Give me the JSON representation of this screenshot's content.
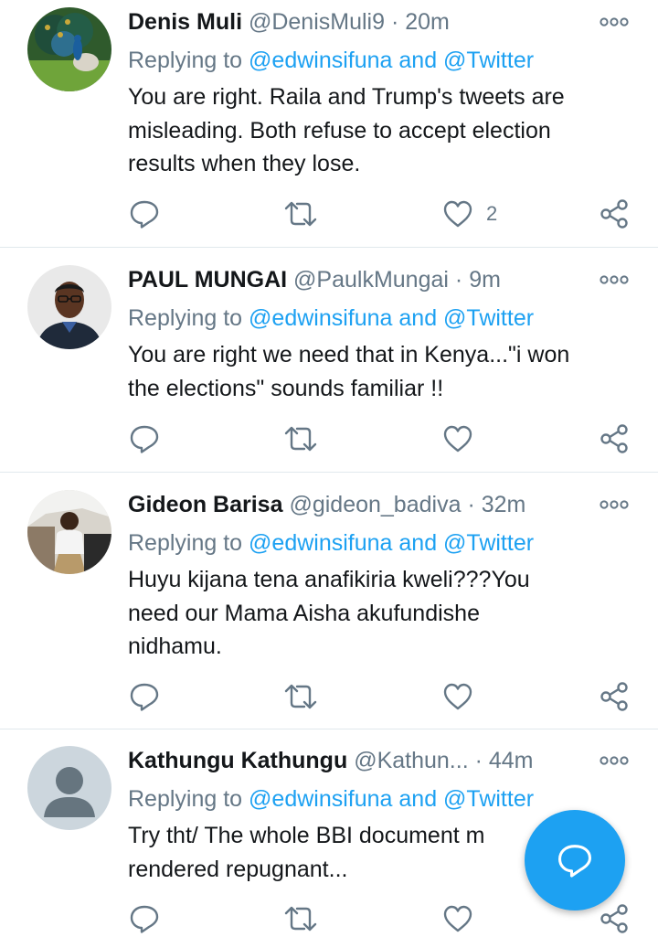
{
  "tweets": [
    {
      "name": "Denis Muli",
      "handle": "@DenisMuli9",
      "dot": "·",
      "time": "20m",
      "reply_prefix": "Replying to",
      "reply_to": "@edwinsifuna and @Twitter",
      "lines": [
        "You are right. Raila and Trump's tweets are",
        "misleading. Both refuse to accept election",
        "results when they lose."
      ],
      "likes": "2",
      "avatar": "peacock-photo"
    },
    {
      "name": "PAUL MUNGAI",
      "handle": "@PaulkMungai",
      "dot": "·",
      "time": "9m",
      "reply_prefix": "Replying to",
      "reply_to": "@edwinsifuna and @Twitter",
      "lines": [
        "You are right we need that in Kenya...\"i won",
        "the elections\" sounds familiar !!"
      ],
      "likes": "",
      "avatar": "man-portrait-photo"
    },
    {
      "name": "Gideon Barisa",
      "handle": "@gideon_badiva",
      "dot": "·",
      "time": "32m",
      "reply_prefix": "Replying to",
      "reply_to": "@edwinsifuna and @Twitter",
      "lines": [
        "Huyu kijana tena anafikiria kweli???You",
        "need our Mama Aisha akufundishe",
        "nidhamu."
      ],
      "likes": "",
      "avatar": "man-in-car-photo"
    },
    {
      "name": "Kathungu Kathungu",
      "handle": "@Kathun...",
      "dot": "·",
      "time": "44m",
      "reply_prefix": "Replying to",
      "reply_to": "@edwinsifuna and @Twitter",
      "lines": [
        "Try tht/ The whole BBI document m",
        "rendered repugnant..."
      ],
      "likes": "",
      "avatar": "default-profile"
    }
  ],
  "icons": {
    "reply": "reply-icon",
    "retweet": "retweet-icon",
    "like": "heart-icon",
    "share": "share-icon",
    "more": "more-dots-icon",
    "compose": "compose-reply-icon"
  },
  "colors": {
    "link": "#1da1f2",
    "muted": "#657786",
    "text": "#14171a",
    "divider": "#e1e8ed",
    "fab": "#1da1f2"
  }
}
